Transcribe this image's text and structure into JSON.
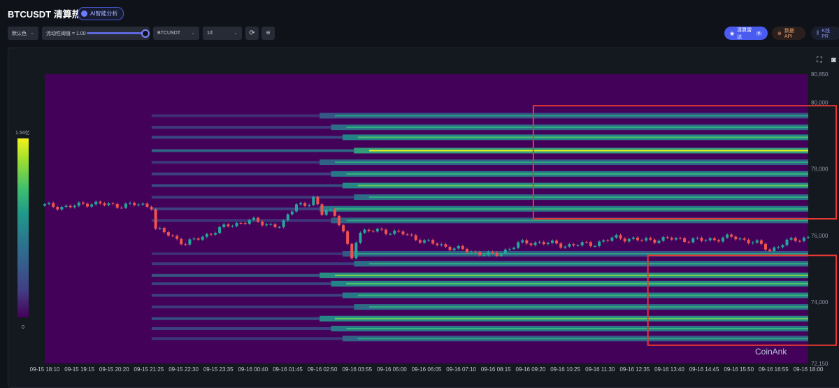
{
  "header": {
    "title": "BTCUSDT 清算热图",
    "ai_badge": "AI智能分析"
  },
  "toolbar": {
    "color_select": "默认色",
    "liquidity_label": "流动性阈值 = 1.00",
    "liquidity_value": 1.0,
    "symbol_select": "BTCUSDT",
    "interval_select": "1d",
    "refresh_icon": "refresh-icon",
    "menu_icon": "list-icon",
    "radar_button": "清算雷达",
    "radar_count": "6",
    "api_button": "数据API",
    "kline_button": "K线 PR"
  },
  "colors": {
    "background": "#0f1319",
    "heatmap_low": "#44015a",
    "heatmap_high": "#f2f21d",
    "candle_up": "#26a69a",
    "candle_down": "#ef5350",
    "highlight_box": "#e53935",
    "accent": "#4a5bf0"
  },
  "colorbar": {
    "max_label": "1.54亿",
    "min_label": "0"
  },
  "watermark": "CoinAnk",
  "chart_data": {
    "type": "heatmap",
    "title": "",
    "xlabel": "",
    "ylabel": "",
    "ylim": [
      72150,
      80850
    ],
    "y_ticks": [
      "80,850",
      "80,000",
      "78,000",
      "76,000",
      "74,000",
      "72,150"
    ],
    "x_ticks": [
      "09-15 18:10",
      "09-15 19:15",
      "09-15 20:20",
      "09-15 21:25",
      "09-15 22:30",
      "09-15 23:35",
      "09-16 00:40",
      "09-16 01:45",
      "09-16 02:50",
      "09-16 03:55",
      "09-16 05:00",
      "09-16 06:05",
      "09-16 07:10",
      "09-16 08:15",
      "09-16 09:20",
      "09-16 10:25",
      "09-16 11:30",
      "09-16 12:35",
      "09-16 13:40",
      "09-16 14:45",
      "09-16 15:50",
      "09-16 16:55",
      "09-16 18:00"
    ],
    "colorbar_range": [
      0,
      "1.54亿"
    ],
    "price_path": [
      {
        "t": 0.0,
        "p": 76900
      },
      {
        "t": 0.03,
        "p": 76850
      },
      {
        "t": 0.06,
        "p": 76980
      },
      {
        "t": 0.09,
        "p": 76900
      },
      {
        "t": 0.12,
        "p": 76930
      },
      {
        "t": 0.14,
        "p": 76880
      },
      {
        "t": 0.145,
        "p": 76200
      },
      {
        "t": 0.16,
        "p": 76050
      },
      {
        "t": 0.185,
        "p": 75750
      },
      {
        "t": 0.21,
        "p": 76000
      },
      {
        "t": 0.24,
        "p": 76300
      },
      {
        "t": 0.27,
        "p": 76450
      },
      {
        "t": 0.29,
        "p": 76350
      },
      {
        "t": 0.31,
        "p": 76250
      },
      {
        "t": 0.32,
        "p": 76650
      },
      {
        "t": 0.33,
        "p": 77000
      },
      {
        "t": 0.345,
        "p": 76850
      },
      {
        "t": 0.355,
        "p": 76950
      },
      {
        "t": 0.365,
        "p": 76600
      },
      {
        "t": 0.37,
        "p": 76950
      },
      {
        "t": 0.35,
        "p": 77200
      },
      {
        "t": 0.395,
        "p": 75950
      },
      {
        "t": 0.4,
        "p": 75100
      },
      {
        "t": 0.41,
        "p": 76100
      },
      {
        "t": 0.44,
        "p": 76150
      },
      {
        "t": 0.47,
        "p": 76050
      },
      {
        "t": 0.5,
        "p": 75800
      },
      {
        "t": 0.53,
        "p": 75650
      },
      {
        "t": 0.56,
        "p": 75500
      },
      {
        "t": 0.59,
        "p": 75400
      },
      {
        "t": 0.62,
        "p": 75750
      },
      {
        "t": 0.65,
        "p": 75800
      },
      {
        "t": 0.68,
        "p": 75700
      },
      {
        "t": 0.72,
        "p": 75750
      },
      {
        "t": 0.75,
        "p": 75950
      },
      {
        "t": 0.78,
        "p": 75850
      },
      {
        "t": 0.82,
        "p": 75900
      },
      {
        "t": 0.86,
        "p": 75850
      },
      {
        "t": 0.9,
        "p": 75950
      },
      {
        "t": 0.93,
        "p": 75800
      },
      {
        "t": 0.95,
        "p": 75550
      },
      {
        "t": 0.97,
        "p": 75800
      },
      {
        "t": 1.0,
        "p": 75950
      }
    ],
    "liquidation_bands": [
      {
        "price": 79600,
        "intensity": 0.4
      },
      {
        "price": 79250,
        "intensity": 0.5
      },
      {
        "price": 78950,
        "intensity": 0.6
      },
      {
        "price": 78550,
        "intensity": 0.85
      },
      {
        "price": 78200,
        "intensity": 0.45
      },
      {
        "price": 77850,
        "intensity": 0.55
      },
      {
        "price": 77500,
        "intensity": 0.65
      },
      {
        "price": 77150,
        "intensity": 0.5
      },
      {
        "price": 76800,
        "intensity": 0.55
      },
      {
        "price": 76450,
        "intensity": 0.45
      },
      {
        "price": 75450,
        "intensity": 0.4
      },
      {
        "price": 75150,
        "intensity": 0.5
      },
      {
        "price": 74800,
        "intensity": 0.7
      },
      {
        "price": 74550,
        "intensity": 0.6
      },
      {
        "price": 74200,
        "intensity": 0.55
      },
      {
        "price": 73850,
        "intensity": 0.5
      },
      {
        "price": 73500,
        "intensity": 0.65
      },
      {
        "price": 73200,
        "intensity": 0.55
      },
      {
        "price": 72900,
        "intensity": 0.45
      }
    ],
    "highlight_boxes": [
      {
        "y_top": 79900,
        "y_bottom": 76500,
        "t_start": 0.64,
        "t_end": 1.0
      },
      {
        "y_top": 75400,
        "y_bottom": 72700,
        "t_start": 0.79,
        "t_end": 1.0
      }
    ]
  }
}
